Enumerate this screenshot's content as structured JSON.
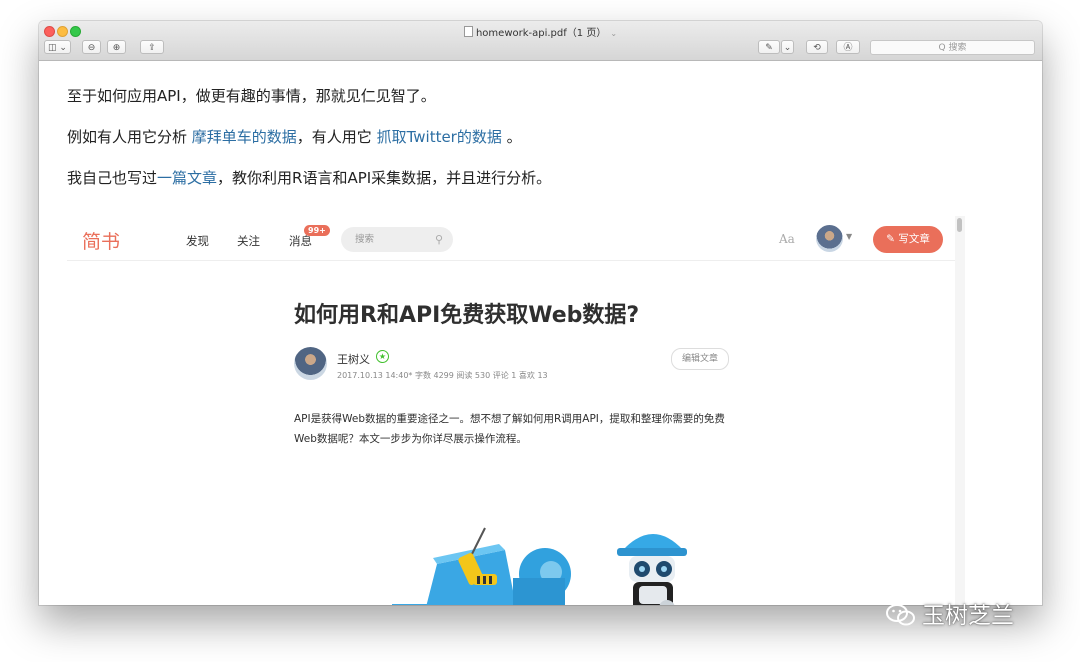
{
  "window": {
    "title": "homework-api.pdf（1 页）",
    "search_placeholder": "Q 搜索"
  },
  "toolbar": {
    "sidebar_label": "◫ ⌄",
    "zoom_out_label": "⊖",
    "zoom_in_label": "⊕",
    "share_label": "⇪",
    "markup_label": "✎",
    "markup_dropdown_label": "⌄",
    "rotate_label": "⟲",
    "annotate_label": "Ⓐ"
  },
  "document": {
    "line1": "至于如何应用API，做更有趣的事情，那就见仁见智了。",
    "line2_prefix": "例如有人用它分析 ",
    "line2_link1": "摩拜单车的数据",
    "line2_mid": "，有人用它 ",
    "line2_link2": "抓取Twitter的数据",
    "line2_suffix": " 。",
    "line3_prefix": "我自己也写过",
    "line3_link": "一篇文章",
    "line3_suffix": "，教你利用R语言和API采集数据，并且进行分析。"
  },
  "embedded": {
    "logo": "简书",
    "nav": [
      "发现",
      "关注",
      "消息"
    ],
    "badge": "99+",
    "search_placeholder": "搜索",
    "aa": "Aa",
    "write_button": "写文章",
    "article_title": "如何用R和API免费获取Web数据?",
    "author": "王树义",
    "meta": "2017.10.13 14:40*  字数 4299  阅读 530  评论 1  喜欢 13",
    "edit_button": "编辑文章",
    "intro": "API是获得Web数据的重要途径之一。想不想了解如何用R调用API，提取和整理你需要的免费Web数据呢？本文一步步为你详尽展示操作流程。"
  },
  "watermark": "玉树芝兰"
}
